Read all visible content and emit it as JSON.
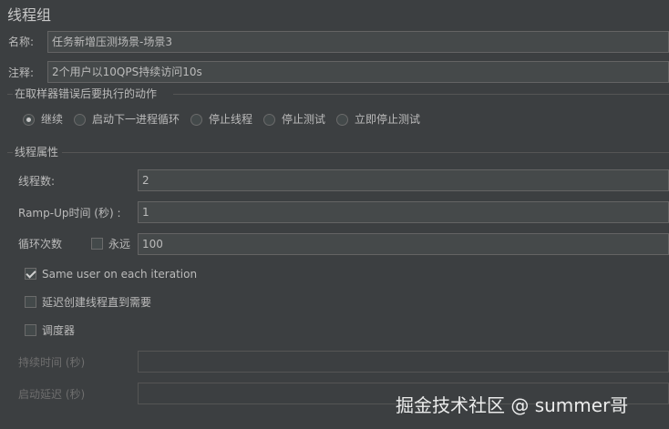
{
  "title": "线程组",
  "name": {
    "label": "名称:",
    "value": "任务新增压测场景-场景3"
  },
  "comment": {
    "label": "注释:",
    "value": "2个用户以10QPS持续访问10s"
  },
  "error_action": {
    "title": "在取样器错误后要执行的动作",
    "options": [
      "继续",
      "启动下一进程循环",
      "停止线程",
      "停止测试",
      "立即停止测试"
    ],
    "selected": "继续"
  },
  "thread_props": {
    "title": "线程属性",
    "num_threads": {
      "label": "线程数:",
      "value": "2"
    },
    "ramp_up": {
      "label": "Ramp-Up时间 (秒) :",
      "value": "1"
    },
    "loop": {
      "label": "循环次数",
      "forever_label": "永远",
      "forever_checked": false,
      "value": "100"
    },
    "same_user": {
      "label": "Same user on each iteration",
      "checked": true
    },
    "delay_create": {
      "label": "延迟创建线程直到需要",
      "checked": false
    },
    "scheduler": {
      "label": "调度器",
      "checked": false
    },
    "duration": {
      "label": "持续时间 (秒)",
      "value": ""
    },
    "startup_delay": {
      "label": "启动延迟 (秒)",
      "value": ""
    }
  },
  "watermark": "掘金技术社区 @ summer哥"
}
